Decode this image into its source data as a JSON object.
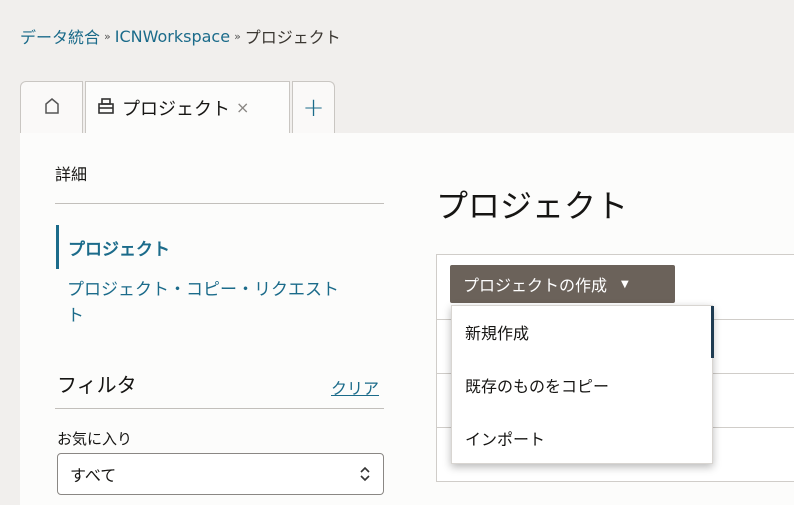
{
  "breadcrumb": {
    "items": [
      "データ統合",
      "ICNWorkspace"
    ],
    "current": "プロジェクト",
    "separator": "»"
  },
  "tabs": {
    "home_icon": "home-icon",
    "project_label": "プロジェクト",
    "project_icon": "project-icon",
    "close": "×",
    "add": "+"
  },
  "sidebar": {
    "title": "詳細",
    "items": [
      {
        "label": "プロジェクト",
        "active": true
      },
      {
        "label": "プロジェクト・コピー・リクエスト",
        "label_line2": "ト",
        "active": false
      }
    ],
    "filter": {
      "title": "フィルタ",
      "clear": "クリア",
      "favorites_label": "お気に入り",
      "favorites_value": "すべて"
    }
  },
  "main": {
    "title": "プロジェクト",
    "create_button": "プロジェクトの作成",
    "menu": [
      "新規作成",
      "既存のものをコピー",
      "インポート"
    ]
  },
  "colors": {
    "accent": "#1b6b8a",
    "button": "#6b625a",
    "background": "#f1efed"
  }
}
